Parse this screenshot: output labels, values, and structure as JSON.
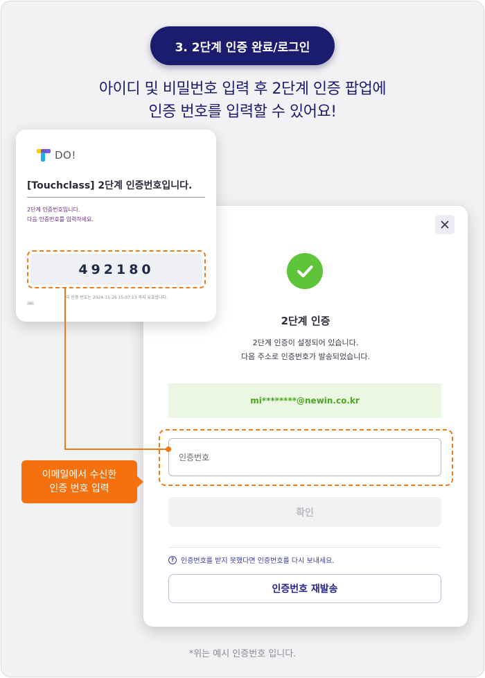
{
  "step_badge": "3. 2단계 인증 완료/로그인",
  "headline": {
    "line1": "아이디 및 비밀번호 입력 후 2단계 인증 팝업에",
    "line2": "인증 번호를 입력할 수 있어요!"
  },
  "email": {
    "logo_text": "DO!",
    "title": "[Touchclass] 2단계 인증번호입니다.",
    "body_line1": "2단계 인증번호입니다.",
    "body_line2": "다음 인증번호를 입력하세요.",
    "code": "492180",
    "expire_note": "이 인증 번호는 2024-11-26 15:07:13 까지 유효합니다.",
    "more": "..."
  },
  "modal": {
    "close_icon": "close-icon",
    "success_icon": "check-circle-icon",
    "title": "2단계 인증",
    "desc_line1": "2단계 인증이 설정되어 있습니다.",
    "desc_line2": "다음 주소로 인증번호가 발송되었습니다.",
    "email_address": "mi********@newin.co.kr",
    "input_placeholder": "인증번호",
    "confirm_label": "확인",
    "resend_note": "인증번호를 받지 못했다면 인증번호를 다시 보내세요.",
    "resend_label": "인증번호 재발송"
  },
  "callout": {
    "line1": "이메일에서 수신한",
    "line2": "인증 번호 입력"
  },
  "footnote": "*위는 예시 인증번호 입니다.",
  "colors": {
    "navy": "#1c1c6e",
    "orange": "#f5710f",
    "success_green": "#5ec43a",
    "email_green_bg": "#ebf7e3"
  }
}
